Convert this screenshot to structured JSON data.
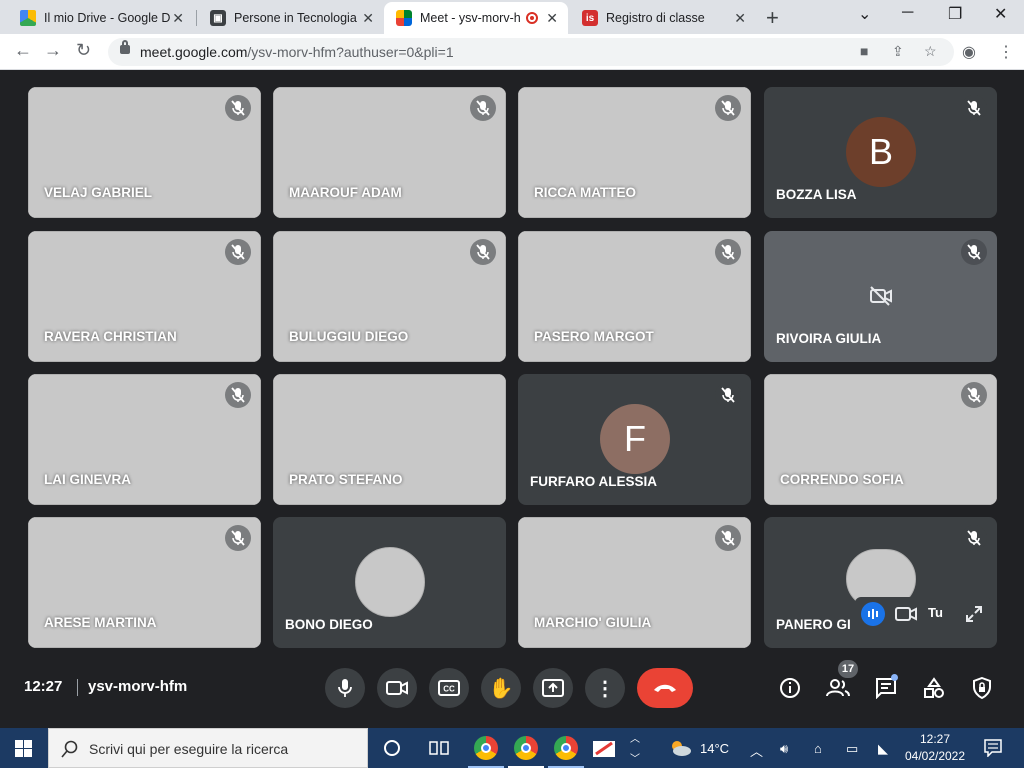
{
  "browser": {
    "tabs": [
      {
        "title": "Il mio Drive - Google D",
        "active": false
      },
      {
        "title": "Persone in Tecnologia",
        "active": false
      },
      {
        "title": "Meet - ysv-morv-h",
        "active": true
      },
      {
        "title": "Registro di classe",
        "active": false
      }
    ],
    "url_host": "meet.google.com",
    "url_path": "/ysv-morv-hfm?authuser=0&pli=1"
  },
  "participants": [
    {
      "name": "VELAJ GABRIEL",
      "type": "video"
    },
    {
      "name": "MAAROUF ADAM",
      "type": "video"
    },
    {
      "name": "RICCA MATTEO",
      "type": "video"
    },
    {
      "name": "BOZZA LISA",
      "type": "avatar",
      "initial": "B",
      "color": "#6d3f2b"
    },
    {
      "name": "RAVERA CHRISTIAN",
      "type": "video"
    },
    {
      "name": "BULUGGIU DIEGO",
      "type": "video"
    },
    {
      "name": "PASERO MARGOT",
      "type": "video"
    },
    {
      "name": "RIVOIRA GIULIA",
      "type": "camera-off"
    },
    {
      "name": "LAI GINEVRA",
      "type": "video"
    },
    {
      "name": "PRATO STEFANO",
      "type": "video"
    },
    {
      "name": "FURFARO ALESSIA",
      "type": "avatar",
      "initial": "F",
      "color": "#8d6e63"
    },
    {
      "name": "CORRENDO SOFIA",
      "type": "video"
    },
    {
      "name": "ARESE MARTINA",
      "type": "video"
    },
    {
      "name": "BONO DIEGO",
      "type": "photo-avatar"
    },
    {
      "name": "MARCHIO' GIULIA",
      "type": "video"
    },
    {
      "name": "PANERO GI",
      "type": "self"
    }
  ],
  "self_view": {
    "label": "Tu"
  },
  "meeting": {
    "time": "12:27",
    "code": "ysv-morv-hfm",
    "participant_count": "17"
  },
  "taskbar": {
    "search_placeholder": "Scrivi qui per eseguire la ricerca",
    "weather": "14°C",
    "time": "12:27",
    "date": "04/02/2022"
  },
  "colors": {
    "meet_bg": "#202124",
    "tile_bg": "#3c4043",
    "hangup": "#ea4335",
    "taskbar": "#1c3a63"
  }
}
